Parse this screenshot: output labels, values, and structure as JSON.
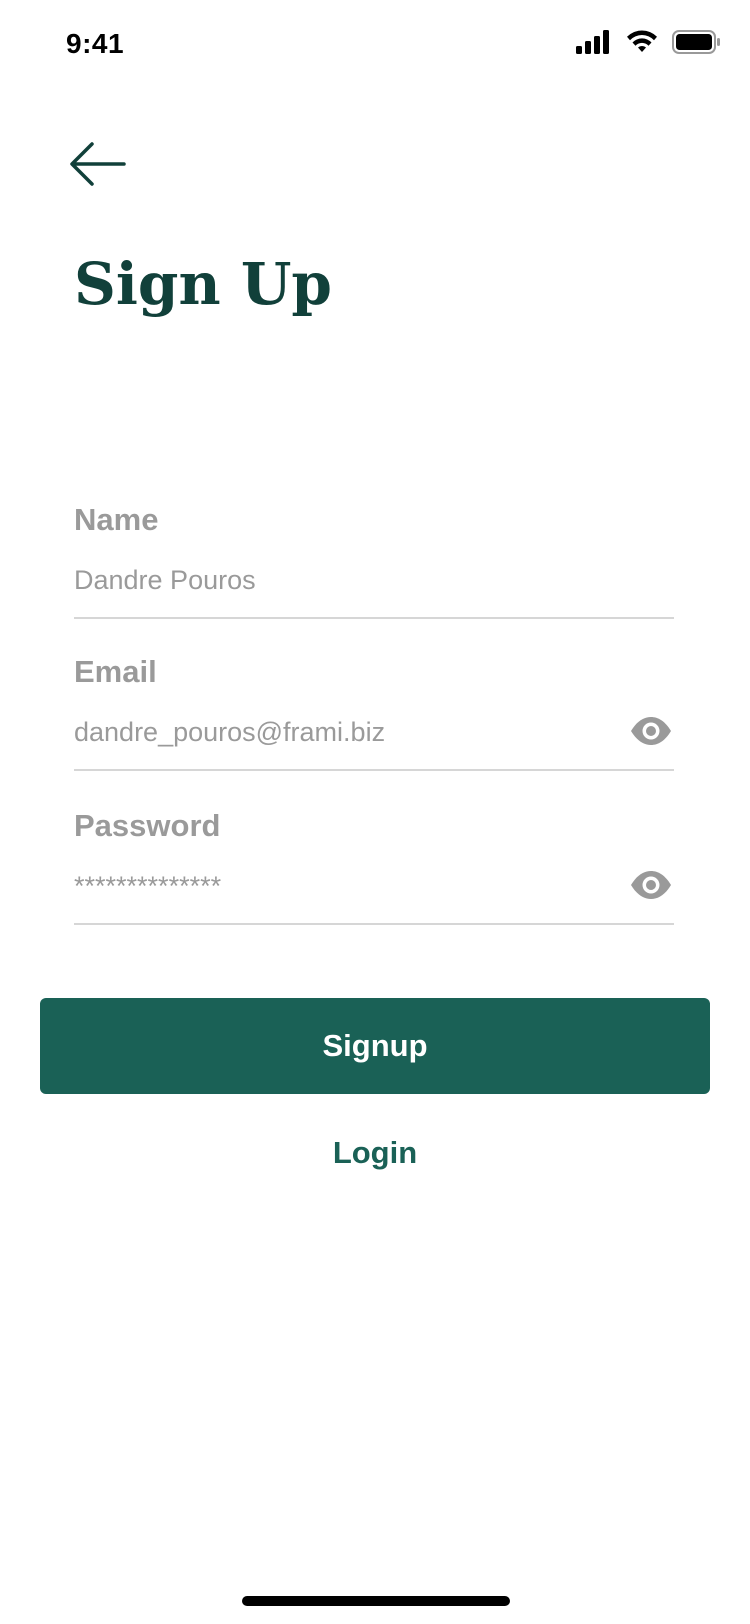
{
  "status_bar": {
    "time": "9:41",
    "icons": [
      "cellular-signal-icon",
      "wifi-icon",
      "battery-icon"
    ]
  },
  "header": {
    "back_icon": "arrow-left-icon",
    "title": "Sign Up"
  },
  "form": {
    "name": {
      "label": "Name",
      "value": "Dandre Pouros"
    },
    "email": {
      "label": "Email",
      "value": "dandre_pouros@frami.biz",
      "icon": "eye-icon"
    },
    "password": {
      "label": "Password",
      "value": "**************",
      "icon": "eye-icon"
    }
  },
  "actions": {
    "signup_label": "Signup",
    "login_label": "Login"
  },
  "colors": {
    "title": "#11403a",
    "primary": "#1a6156",
    "label": "#9a9a9a",
    "divider": "#d6d6d6"
  }
}
